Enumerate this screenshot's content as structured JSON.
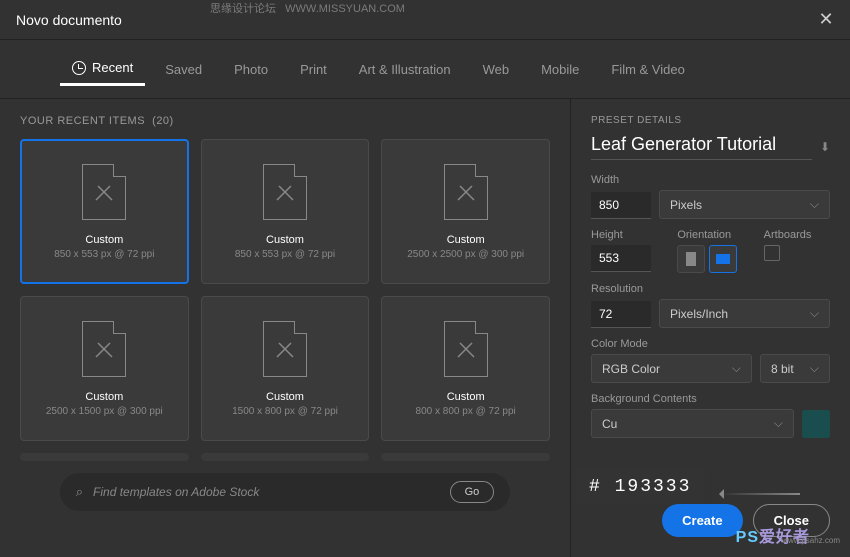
{
  "window": {
    "title": "Novo documento"
  },
  "tabs": [
    "Recent",
    "Saved",
    "Photo",
    "Print",
    "Art & Illustration",
    "Web",
    "Mobile",
    "Film & Video"
  ],
  "recent": {
    "label": "YOUR RECENT ITEMS",
    "count": "(20)"
  },
  "cards": [
    {
      "title": "Custom",
      "sub": "850 x 553 px @ 72 ppi"
    },
    {
      "title": "Custom",
      "sub": "850 x 553 px @ 72 ppi"
    },
    {
      "title": "Custom",
      "sub": "2500 x 2500 px @ 300 ppi"
    },
    {
      "title": "Custom",
      "sub": "2500 x 1500 px @ 300 ppi"
    },
    {
      "title": "Custom",
      "sub": "1500 x 800 px @ 72 ppi"
    },
    {
      "title": "Custom",
      "sub": "800 x 800 px @ 72 ppi"
    }
  ],
  "search": {
    "placeholder": "Find templates on Adobe Stock",
    "go": "Go"
  },
  "preset": {
    "label": "PRESET DETAILS",
    "name": "Leaf Generator Tutorial",
    "width_label": "Width",
    "width": "850",
    "width_unit": "Pixels",
    "height_label": "Height",
    "height": "553",
    "orient_label": "Orientation",
    "artboards_label": "Artboards",
    "res_label": "Resolution",
    "res": "72",
    "res_unit": "Pixels/Inch",
    "color_label": "Color Mode",
    "color": "RGB Color",
    "bit": "8 bit",
    "bg_label": "Background Contents",
    "bg": "Cu"
  },
  "overlay": "# 193333",
  "buttons": {
    "create": "Create",
    "close": "Close"
  },
  "watermark": {
    "top": "思缘设计论坛",
    "bottom": "爱好者",
    "site": "WWW.MISSYUAN.COM",
    "url": "www.psahz.com"
  }
}
